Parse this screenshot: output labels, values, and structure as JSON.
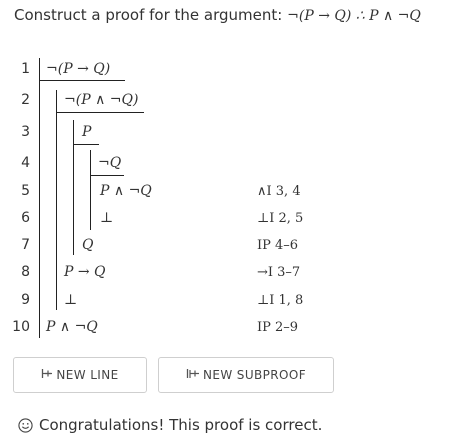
{
  "problem": {
    "prefix": "Construct a proof for the argument:",
    "formula": "¬(P → Q) ∴ P ∧ ¬Q"
  },
  "proof": {
    "lines": [
      {
        "num": "1",
        "formula": "¬(P → Q)",
        "justification": ""
      },
      {
        "num": "2",
        "formula": "¬(P ∧ ¬Q)",
        "justification": ""
      },
      {
        "num": "3",
        "formula": "P",
        "justification": ""
      },
      {
        "num": "4",
        "formula": "¬Q",
        "justification": ""
      },
      {
        "num": "5",
        "formula": "P ∧ ¬Q",
        "justification": "∧I 3, 4"
      },
      {
        "num": "6",
        "formula": "⊥",
        "justification": "⊥I 2, 5"
      },
      {
        "num": "7",
        "formula": "Q",
        "justification": "IP 4–6"
      },
      {
        "num": "8",
        "formula": "P → Q",
        "justification": "→I 3–7"
      },
      {
        "num": "9",
        "formula": "⊥",
        "justification": "⊥I 1, 8"
      },
      {
        "num": "10",
        "formula": "P ∧ ¬Q",
        "justification": "IP 2–9"
      }
    ]
  },
  "buttons": {
    "new_line": "NEW LINE",
    "new_subproof": "NEW SUBPROOF"
  },
  "status": {
    "icon": "smiley-icon",
    "message": "Congratulations! This proof is correct."
  }
}
